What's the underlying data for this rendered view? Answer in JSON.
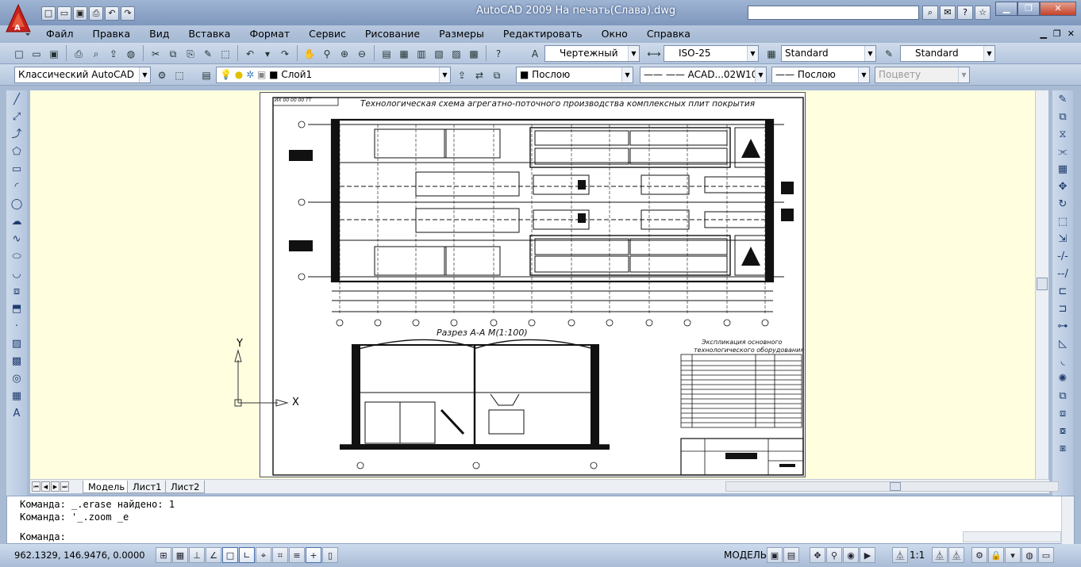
{
  "titlebar": {
    "title": "AutoCAD 2009 На печать(Слава).dwg",
    "search_placeholder": "",
    "quick_access_icons": [
      "new-icon",
      "open-icon",
      "save-icon",
      "print-icon",
      "undo-icon",
      "redo-icon"
    ]
  },
  "menu": {
    "items": [
      "Файл",
      "Правка",
      "Вид",
      "Вставка",
      "Формат",
      "Сервис",
      "Рисование",
      "Размеры",
      "Редактировать",
      "Окно",
      "Справка"
    ]
  },
  "toolbar1": {
    "text_style": "Чертежный",
    "dim_style": "ISO-25",
    "table_style": "Standard",
    "mleader_style": "Standard"
  },
  "toolbar2": {
    "workspace": "Классический AutoCAD",
    "layer": "Слой1",
    "color": "Послою",
    "linetype": "ACAD...02W10",
    "lineweight": "Послою",
    "plotstyle": "Поцвету"
  },
  "drawing": {
    "stamp": "ИХ 00 00 00 ТТ",
    "title": "Технологическая схема агрегатно-поточного производства комплексных плит покрытия",
    "section_title": "Разрез А-А М(1:100)",
    "explication_title_1": "Экспликация основного",
    "explication_title_2": "технологического оборудования",
    "ucs_y": "Y",
    "ucs_x": "X"
  },
  "tabs": {
    "items": [
      "Модель",
      "Лист1",
      "Лист2"
    ],
    "active": "Модель"
  },
  "command": {
    "history": [
      "Команда: _.erase найдено: 1",
      "Команда: '_.zoom _e"
    ],
    "prompt": "Команда:"
  },
  "status": {
    "coords": "962.1329, 146.9476, 0.0000",
    "model": "МОДЕЛЬ",
    "scale": "1:1"
  },
  "colors": {
    "canvas": "#ffffe0",
    "chrome": "#b3c5dd",
    "title_gradient": "#7e97bd"
  }
}
